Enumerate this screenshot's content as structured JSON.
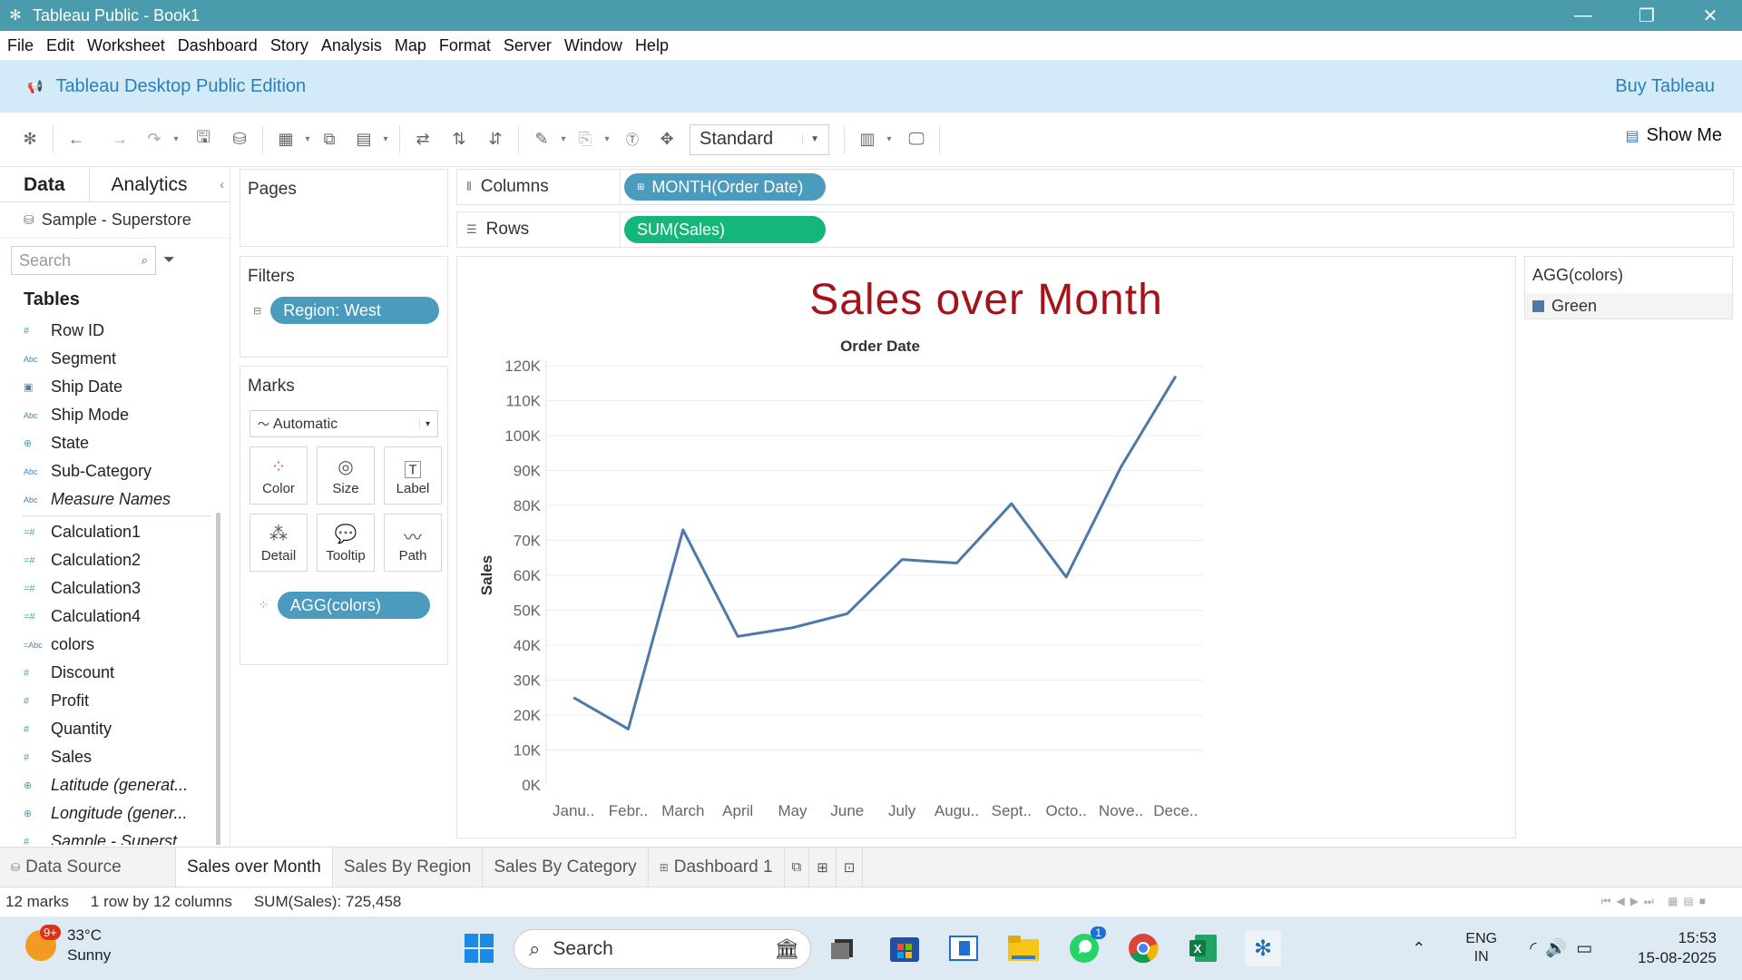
{
  "window": {
    "title": "Tableau Public - Book1",
    "controls": [
      "—",
      "❐",
      "✕"
    ]
  },
  "menu": [
    "File",
    "Edit",
    "Worksheet",
    "Dashboard",
    "Story",
    "Analysis",
    "Map",
    "Format",
    "Server",
    "Window",
    "Help"
  ],
  "banner": {
    "edition": "Tableau Desktop Public Edition",
    "buy": "Buy Tableau"
  },
  "toolbar": {
    "fit": "Standard",
    "show_me": "Show Me"
  },
  "datapane": {
    "tabs": [
      "Data",
      "Analytics"
    ],
    "source": "Sample - Superstore",
    "search_placeholder": "Search",
    "tables_heading": "Tables",
    "fields": [
      {
        "name": "Row ID",
        "type": "#"
      },
      {
        "name": "Segment",
        "type": "Abc"
      },
      {
        "name": "Ship Date",
        "type": "date"
      },
      {
        "name": "Ship Mode",
        "type": "Abc"
      },
      {
        "name": "State",
        "type": "geo"
      },
      {
        "name": "Sub-Category",
        "type": "Abc"
      },
      {
        "name": "Measure Names",
        "type": "Abc",
        "italic": true
      },
      {
        "name": "Calculation1",
        "type": "=#"
      },
      {
        "name": "Calculation2",
        "type": "=#"
      },
      {
        "name": "Calculation3",
        "type": "=#"
      },
      {
        "name": "Calculation4",
        "type": "=#"
      },
      {
        "name": "colors",
        "type": "=Abc"
      },
      {
        "name": "Discount",
        "type": "#"
      },
      {
        "name": "Profit",
        "type": "#"
      },
      {
        "name": "Quantity",
        "type": "#"
      },
      {
        "name": "Sales",
        "type": "#"
      },
      {
        "name": "Latitude (generat...",
        "type": "geo",
        "italic": true
      },
      {
        "name": "Longitude (gener...",
        "type": "geo",
        "italic": true
      },
      {
        "name": "Sample - Superst...",
        "type": "#",
        "italic": true
      }
    ]
  },
  "pages": {
    "label": "Pages"
  },
  "filters": {
    "label": "Filters",
    "pill": "Region: West"
  },
  "marks": {
    "label": "Marks",
    "type": "Automatic",
    "buttons": [
      "Color",
      "Size",
      "Label",
      "Detail",
      "Tooltip",
      "Path"
    ],
    "pill": "AGG(colors)"
  },
  "shelves": {
    "columns_label": "Columns",
    "columns_pill": "MONTH(Order Date)",
    "rows_label": "Rows",
    "rows_pill": "SUM(Sales)"
  },
  "legend": {
    "title": "AGG(colors)",
    "item": "Green",
    "color": "#4e79a7"
  },
  "sheet_tabs": [
    "Data Source",
    "Sales over Month",
    "Sales By Region",
    "Sales By Category",
    "Dashboard 1"
  ],
  "status": {
    "marks": "12 marks",
    "dims": "1 row by 12 columns",
    "sum": "SUM(Sales): 725,458"
  },
  "taskbar": {
    "temp": "33°C",
    "cond": "Sunny",
    "badge": "9+",
    "search": "Search",
    "lang1": "ENG",
    "lang2": "IN",
    "time": "15:53",
    "date": "15-08-2025",
    "whatsapp_badge": "1"
  },
  "chart_data": {
    "type": "line",
    "title": "Sales over Month",
    "xlabel": "Order Date",
    "ylabel": "Sales",
    "categories": [
      "Janu..",
      "Febr..",
      "March",
      "April",
      "May",
      "June",
      "July",
      "Augu..",
      "Sept..",
      "Octo..",
      "Nove..",
      "Dece.."
    ],
    "values": [
      25000,
      16000,
      73000,
      42500,
      45000,
      49000,
      64500,
      63500,
      80500,
      59500,
      91000,
      117000
    ],
    "ylim": [
      0,
      120000
    ],
    "yticks": [
      "0K",
      "10K",
      "20K",
      "30K",
      "40K",
      "50K",
      "60K",
      "70K",
      "80K",
      "90K",
      "100K",
      "110K",
      "120K"
    ],
    "grid": true,
    "color": "#4e79a7"
  }
}
